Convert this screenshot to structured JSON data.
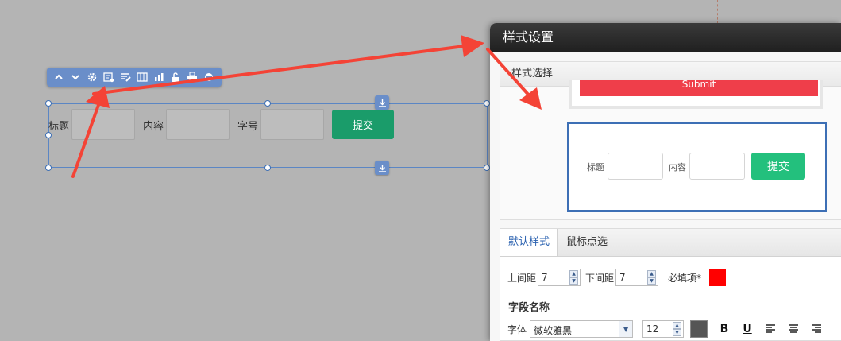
{
  "canvas": {
    "form": {
      "title_label": "标题",
      "content_label": "内容",
      "size_label": "字号",
      "submit_label": "提交"
    },
    "toolbar_icons": [
      "chevron-up-icon",
      "chevron-down-icon",
      "gear-icon",
      "form-settings-icon",
      "edit-list-icon",
      "columns-icon",
      "bar-chart-icon",
      "unlock-icon",
      "printer-icon",
      "refresh-icon"
    ]
  },
  "dialog": {
    "title": "样式设置",
    "style_select_header": "样式选择",
    "sample1_button": "Submit",
    "sample2": {
      "title_label": "标题",
      "content_label": "内容",
      "submit_label": "提交"
    },
    "tabs": [
      {
        "label": "默认样式",
        "active": true
      },
      {
        "label": "鼠标点选",
        "active": false
      }
    ],
    "top_margin_label": "上间距",
    "top_margin_value": "7",
    "bottom_margin_label": "下间距",
    "bottom_margin_value": "7",
    "required_label": "必填项*",
    "required_color": "#ff0000",
    "field_name_title": "字段名称",
    "font_label": "字体",
    "font_value": "微软雅黑",
    "font_size_value": "12",
    "text_color": "#555555",
    "bold_label": "B",
    "underline_label": "U"
  },
  "colors": {
    "accent_blue": "#3d6fb5",
    "submit_green": "#1a9c6a",
    "arrow_red": "#f44336"
  }
}
